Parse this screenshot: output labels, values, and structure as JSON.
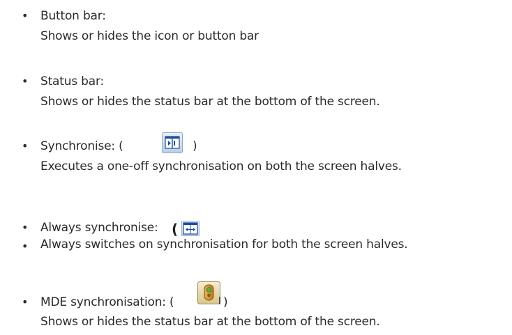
{
  "items": [
    {
      "title": "Button bar:",
      "desc": "Shows or hides the icon or button bar"
    },
    {
      "title": "Status bar:",
      "desc": "Shows or hides the status bar at the bottom of the screen."
    },
    {
      "title_prefix": "Synchronise: (",
      "title_suffix": ")",
      "icon": "synchronise-icon",
      "desc": "Executes a one-off synchronisation on both the screen halves."
    },
    {
      "title": "Always synchronise:",
      "paren": "(",
      "icon": "always-synchronise-icon",
      "desc": "Always switches on synchronisation for both the screen halves."
    },
    {
      "title_prefix": "MDE synchronisation: (",
      "title_suffix": ")",
      "icon": "mde-synchronisation-icon",
      "desc": "Shows or hides the status bar at the bottom of the screen."
    }
  ],
  "bullet_char": "•"
}
